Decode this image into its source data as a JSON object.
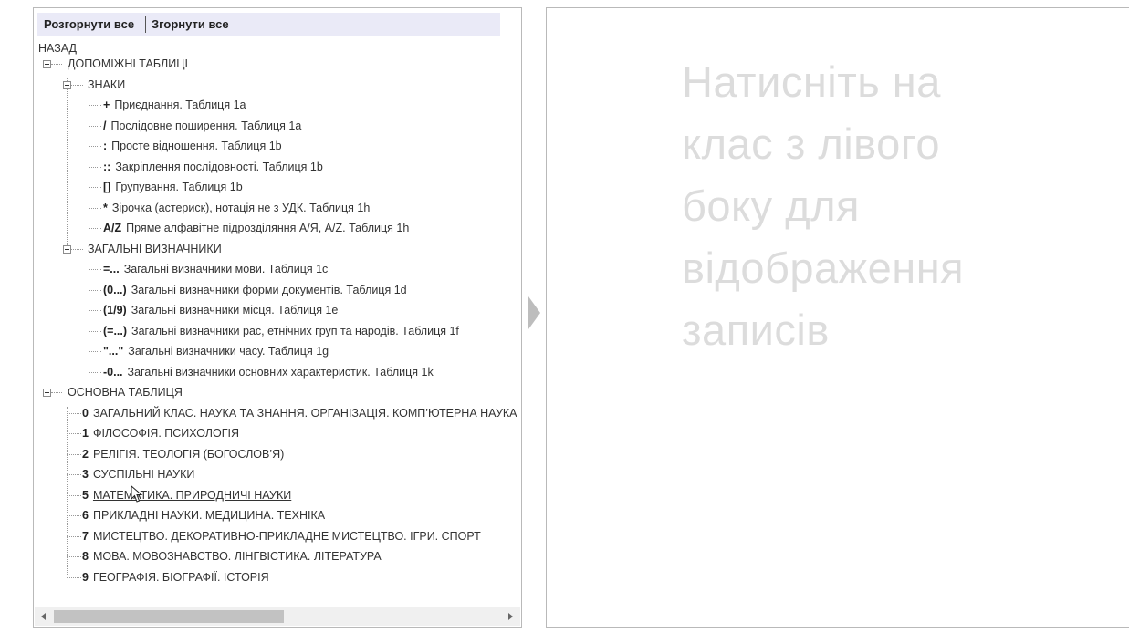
{
  "toolbar": {
    "expand_all": "Розгорнути все",
    "collapse_all": "Згорнути все"
  },
  "tree": {
    "back": "НАЗАД",
    "aux_tables": "ДОПОМІЖНІ ТАБЛИЦІ",
    "signs": {
      "label": "ЗНАКИ",
      "items": [
        {
          "code": "+",
          "text": "Приєднання. Таблиця 1a"
        },
        {
          "code": "/",
          "text": "Послідовне поширення. Таблиця 1a"
        },
        {
          "code": ":",
          "text": "Просте відношення. Таблиця 1b"
        },
        {
          "code": "::",
          "text": "Закріплення послідовності. Таблиця 1b"
        },
        {
          "code": "[]",
          "text": "Групування. Таблиця 1b"
        },
        {
          "code": "*",
          "text": "Зірочка (астериск), нотація не з УДК. Таблиця 1h"
        },
        {
          "code": "A/Z",
          "text": "Пряме алфавітне підрозділяння А/Я, A/Z. Таблиця 1h"
        }
      ]
    },
    "general": {
      "label": "ЗАГАЛЬНІ ВИЗНАЧНИКИ",
      "items": [
        {
          "code": "=...",
          "text": "Загальні визначники мови. Таблиця 1c"
        },
        {
          "code": "(0...)",
          "text": "Загальні визначники форми документів. Таблиця 1d"
        },
        {
          "code": "(1/9)",
          "text": "Загальні визначники місця. Таблиця 1e"
        },
        {
          "code": "(=...)",
          "text": "Загальні визначники рас, етнічних груп та народів. Таблиця 1f"
        },
        {
          "code": "\"...\"",
          "text": "Загальні визначники часу. Таблиця 1g"
        },
        {
          "code": "-0...",
          "text": "Загальні визначники основних характеристик. Таблиця 1k"
        }
      ]
    },
    "main_table": {
      "label": "ОСНОВНА ТАБЛИЦЯ",
      "items": [
        {
          "code": "0",
          "text": "ЗАГАЛЬНИЙ КЛАС. НАУКА ТА ЗНАННЯ. ОРГАНІЗАЦІЯ. КОМП’ЮТЕРНА НАУКА"
        },
        {
          "code": "1",
          "text": "ФІЛОСОФІЯ. ПСИХОЛОГІЯ"
        },
        {
          "code": "2",
          "text": "РЕЛІГІЯ. ТЕОЛОГІЯ (БОГОСЛОВ’Я)"
        },
        {
          "code": "3",
          "text": "СУСПІЛЬНІ НАУКИ"
        },
        {
          "code": "5",
          "text": "МАТЕМАТИКА. ПРИРОДНИЧІ НАУКИ"
        },
        {
          "code": "6",
          "text": "ПРИКЛАДНІ НАУКИ. МЕДИЦИНА. ТЕХНІКА"
        },
        {
          "code": "7",
          "text": "МИСТЕЦТВО. ДЕКОРАТИВНО-ПРИКЛАДНЕ МИСТЕЦТВО. ІГРИ. СПОРТ"
        },
        {
          "code": "8",
          "text": "МОВА. МОВОЗНАВСТВО. ЛІНГВІСТИКА. ЛІТЕРАТУРА"
        },
        {
          "code": "9",
          "text": "ГЕОГРАФІЯ. БІОГРАФІЇ. ІСТОРІЯ"
        }
      ]
    }
  },
  "placeholder": "Натисніть на клас з лівого боку для відображення записів",
  "hovered_item_code": "5"
}
